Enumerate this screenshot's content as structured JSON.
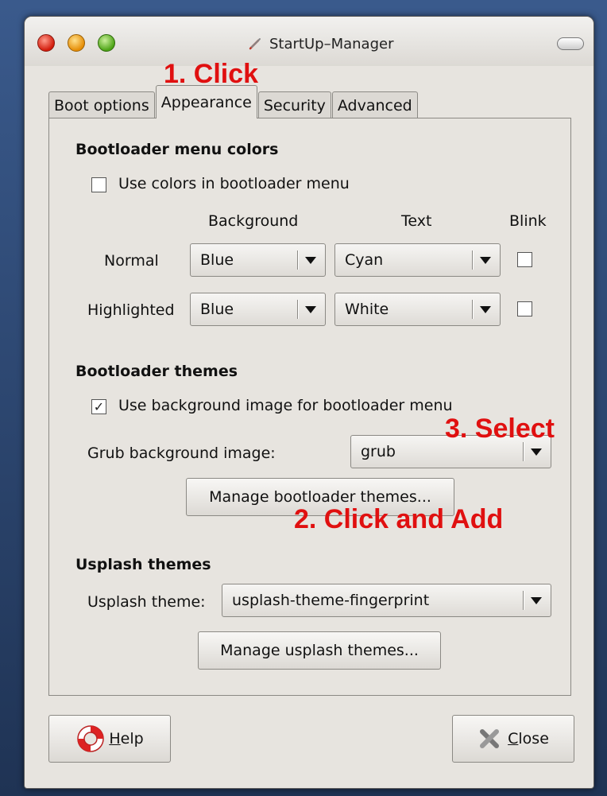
{
  "window": {
    "title": "StartUp–Manager",
    "icon": "wrench-screwdriver-icon"
  },
  "tabs": [
    {
      "label": "Boot options",
      "active": false
    },
    {
      "label": "Appearance",
      "active": true
    },
    {
      "label": "Security",
      "active": false
    },
    {
      "label": "Advanced",
      "active": false
    }
  ],
  "colors_section": {
    "title": "Bootloader menu colors",
    "use_colors": {
      "label": "Use colors in bootloader menu",
      "checked": false
    },
    "headers": {
      "background": "Background",
      "text": "Text",
      "blink": "Blink"
    },
    "rows": [
      {
        "label": "Normal",
        "background": "Blue",
        "text": "Cyan",
        "blink": false
      },
      {
        "label": "Highlighted",
        "background": "Blue",
        "text": "White",
        "blink": false
      }
    ]
  },
  "themes_section": {
    "title": "Bootloader themes",
    "use_bg": {
      "label": "Use background image for bootloader menu",
      "checked": true,
      "check_glyph": "✓"
    },
    "grub_label": "Grub background image:",
    "grub_value": "grub",
    "manage_button": "Manage bootloader themes..."
  },
  "usplash_section": {
    "title": "Usplash themes",
    "theme_label": "Usplash theme:",
    "theme_value": "usplash-theme-fingerprint",
    "manage_button": "Manage usplash themes..."
  },
  "footer": {
    "help": "Help",
    "close": "Close"
  },
  "annotations": {
    "step1": "1. Click",
    "step2": "2. Click and Add",
    "step3": "3. Select",
    "color": "#e01010"
  }
}
